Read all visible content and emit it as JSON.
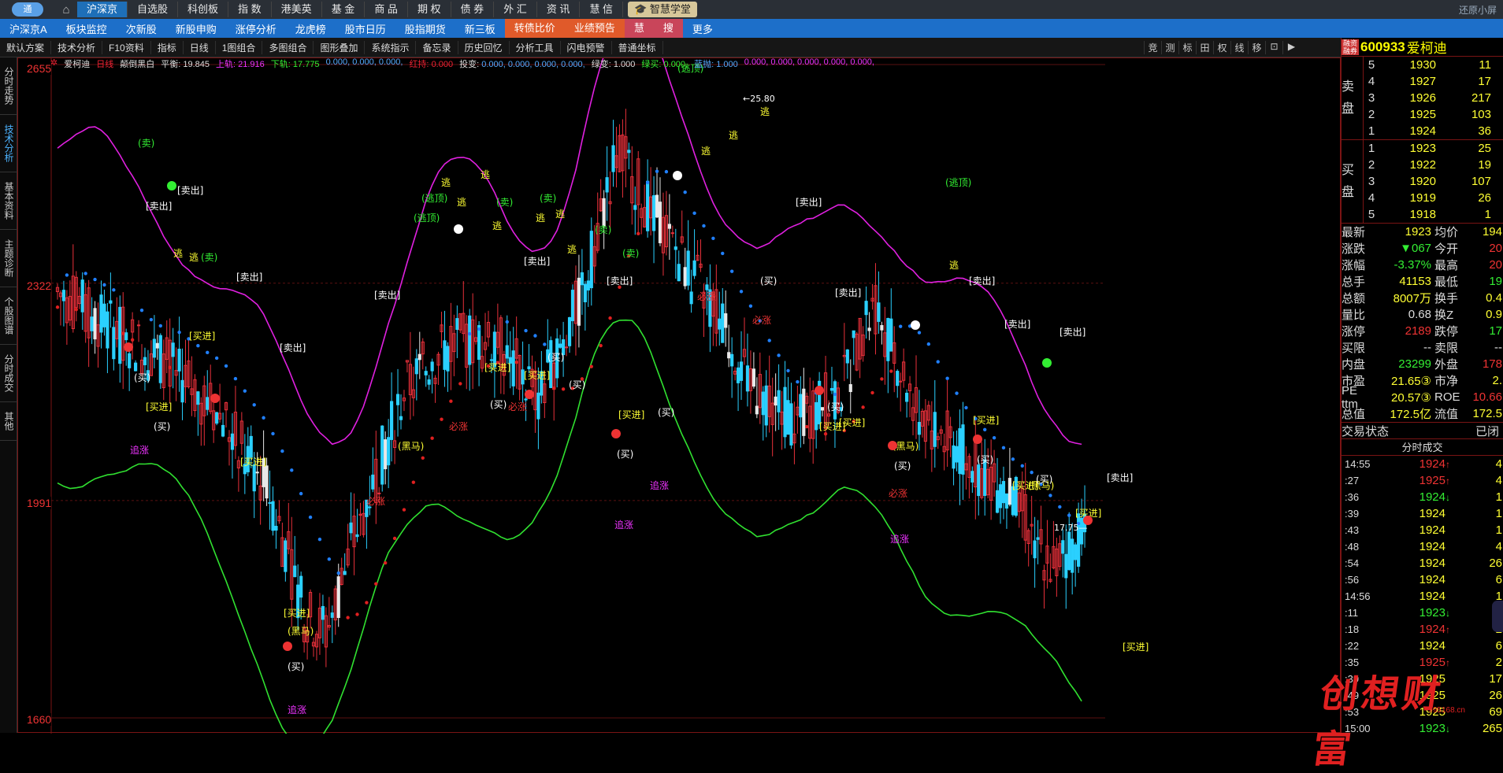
{
  "topbar": {
    "logo": "通",
    "items": [
      "沪深京",
      "自选股",
      "科创板",
      "指 数",
      "港美英",
      "基 金",
      "商 品",
      "期 权",
      "债 券",
      "外 汇",
      "资 讯",
      "慧 信"
    ],
    "academy": "智慧学堂",
    "resize_label": "还原小屏"
  },
  "subbar": {
    "items": [
      "沪深京A",
      "板块监控",
      "次新股",
      "新股申购",
      "涨停分析",
      "龙虎榜",
      "股市日历",
      "股指期货",
      "新三板"
    ],
    "orange_items": [
      "转债比价",
      "业绩预告"
    ],
    "highlight_items": [
      "慧",
      "搜"
    ],
    "more": "更多"
  },
  "toolbar": {
    "items": [
      "默认方案",
      "技术分析",
      "F10资料",
      "指标",
      "日线",
      "1图组合",
      "多图组合",
      "图形叠加",
      "系统指示",
      "备忘录",
      "历史回忆",
      "分析工具",
      "闪电预警",
      "普通坐标"
    ],
    "right_items": [
      "竞",
      "测",
      "标",
      "田",
      "权",
      "线",
      "移",
      "⊡",
      "▶"
    ]
  },
  "sidebar": {
    "tabs": [
      "分时走势",
      "技术分析",
      "基本资料",
      "主题诊断",
      "个股图谱",
      "分时成交",
      "其他"
    ]
  },
  "chart_info": {
    "stock_name": "爱柯迪",
    "period": "日线",
    "theme": "颠倒黑白",
    "balance_label": "平衡:",
    "balance": "19.845",
    "upper_label": "上轨:",
    "upper": "21.916",
    "lower_label": "下轨:",
    "lower": "17.775",
    "zeros1": "0.000, 0.000, 0.000,",
    "hongchi_label": "红持:",
    "hongchi": "0.000",
    "tubian_label": "投变:",
    "tubian": "0.000, 0.000, 0.000, 0.000,",
    "lvbian_label": "绿变:",
    "lvbian": "1.000",
    "lvmai_label": "绿买:",
    "lvmai": "0.000,",
    "lanmai_label": "蓝抛:",
    "lanmai": "1.000",
    "zeros2": "0.000, 0.000, 0.000, 0.000, 0.000,"
  },
  "price_labels": [
    "2655",
    "2322",
    "1991",
    "1660"
  ],
  "annotations": {
    "high_mark": "25.80",
    "low_mark": "17.75"
  },
  "panel": {
    "badge": "融资融券",
    "code": "600933",
    "name": "爱柯迪",
    "sell_label": "卖盘",
    "buy_label": "买盘",
    "asks": [
      {
        "level": "5",
        "price": "1930",
        "vol": "11"
      },
      {
        "level": "4",
        "price": "1927",
        "vol": "17"
      },
      {
        "level": "3",
        "price": "1926",
        "vol": "217"
      },
      {
        "level": "2",
        "price": "1925",
        "vol": "103"
      },
      {
        "level": "1",
        "price": "1924",
        "vol": "36"
      }
    ],
    "bids": [
      {
        "level": "1",
        "price": "1923",
        "vol": "25"
      },
      {
        "level": "2",
        "price": "1922",
        "vol": "19"
      },
      {
        "level": "3",
        "price": "1920",
        "vol": "107"
      },
      {
        "level": "4",
        "price": "1919",
        "vol": "26"
      },
      {
        "level": "5",
        "price": "1918",
        "vol": "1"
      }
    ],
    "quotes": [
      {
        "k": "最新",
        "v": "1923",
        "vc": "#ff3",
        "k2": "均价",
        "v2": "194",
        "v2c": "#ff3"
      },
      {
        "k": "涨跌",
        "v": "▼067",
        "vc": "#3e3",
        "k2": "今开",
        "v2": "20",
        "v2c": "#e33"
      },
      {
        "k": "涨幅",
        "v": "-3.37%",
        "vc": "#3e3",
        "k2": "最高",
        "v2": "20",
        "v2c": "#e33"
      },
      {
        "k": "总手",
        "v": "41153",
        "vc": "#ff3",
        "k2": "最低",
        "v2": "19",
        "v2c": "#3e3"
      },
      {
        "k": "总额",
        "v": "8007万",
        "vc": "#ff3",
        "k2": "换手",
        "v2": "0.4",
        "v2c": "#ff3"
      },
      {
        "k": "量比",
        "v": "0.68",
        "vc": "#ddd",
        "k2": "换Z",
        "v2": "0.9",
        "v2c": "#ff3"
      },
      {
        "k": "涨停",
        "v": "2189",
        "vc": "#e33",
        "k2": "跌停",
        "v2": "17",
        "v2c": "#3e3"
      },
      {
        "k": "买限",
        "v": "--",
        "vc": "#ddd",
        "k2": "卖限",
        "v2": "--",
        "v2c": "#ddd"
      },
      {
        "k": "内盘",
        "v": "23299",
        "vc": "#3e3",
        "k2": "外盘",
        "v2": "178",
        "v2c": "#e33"
      },
      {
        "k": "市盈",
        "v": "21.65③",
        "vc": "#ff3",
        "k2": "市净",
        "v2": "2.",
        "v2c": "#ff3"
      },
      {
        "k": "PE ttm",
        "v": "20.57③",
        "vc": "#ff3",
        "k2": "ROE",
        "v2": "10.66",
        "v2c": "#e33"
      },
      {
        "k": "总值",
        "v": "172.5亿",
        "vc": "#ff3",
        "k2": "流值",
        "v2": "172.5",
        "v2c": "#ff3"
      }
    ],
    "trade_status_label": "交易状态",
    "trade_status": "已闭",
    "ticks_header": "分时成交",
    "ticks": [
      {
        "t": "14:55",
        "p": "1924",
        "a": "↑",
        "ac": "#e33",
        "q": "4"
      },
      {
        "t": ":27",
        "p": "1925",
        "a": "↑",
        "ac": "#e33",
        "q": "4"
      },
      {
        "t": ":36",
        "p": "1924",
        "a": "↓",
        "ac": "#3e3",
        "q": "1"
      },
      {
        "t": ":39",
        "p": "1924",
        "a": "",
        "ac": "#ddd",
        "q": "1"
      },
      {
        "t": ":43",
        "p": "1924",
        "a": "",
        "ac": "#ddd",
        "q": "1"
      },
      {
        "t": ":48",
        "p": "1924",
        "a": "",
        "ac": "#ddd",
        "q": "4"
      },
      {
        "t": ":54",
        "p": "1924",
        "a": "",
        "ac": "#ddd",
        "q": "26"
      },
      {
        "t": ":56",
        "p": "1924",
        "a": "",
        "ac": "#ddd",
        "q": "6"
      },
      {
        "t": "14:56",
        "p": "1924",
        "a": "",
        "ac": "#ddd",
        "q": "1"
      },
      {
        "t": ":11",
        "p": "1923",
        "a": "↓",
        "ac": "#3e3",
        "q": "1"
      },
      {
        "t": ":18",
        "p": "1924",
        "a": "↑",
        "ac": "#e33",
        "q": "2"
      },
      {
        "t": ":22",
        "p": "1924",
        "a": "",
        "ac": "#ddd",
        "q": "6"
      },
      {
        "t": ":35",
        "p": "1925",
        "a": "↑",
        "ac": "#e33",
        "q": "2"
      },
      {
        "t": ":39",
        "p": "1925",
        "a": "",
        "ac": "#ddd",
        "q": "17"
      },
      {
        "t": ":49",
        "p": "1925",
        "a": "",
        "ac": "#ddd",
        "q": "26"
      },
      {
        "t": ":53",
        "p": "1925",
        "a": "",
        "ac": "#ddd",
        "q": "69"
      },
      {
        "t": "15:00",
        "p": "1923",
        "a": "↓",
        "ac": "#3e3",
        "q": "265"
      }
    ]
  },
  "watermark": {
    "text": "创想财富",
    "url": "995168.cn"
  },
  "colors": {
    "up": "#e8303a",
    "down": "#2ad0ff",
    "upper_band": "#e020e0",
    "lower_band": "#30e030",
    "dots_up": "#e02020",
    "dots_down": "#2080ff"
  }
}
